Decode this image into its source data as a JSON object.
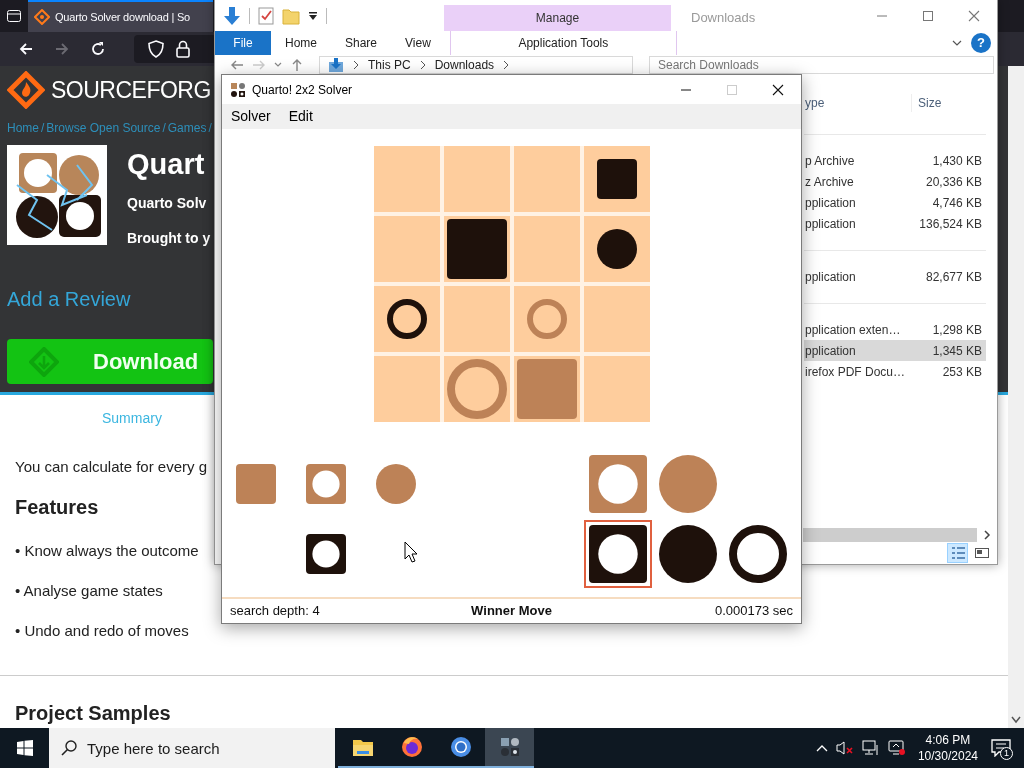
{
  "browser": {
    "tab": {
      "title": "Quarto Solver download | So",
      "selected": true
    },
    "nav_buttons": [
      {
        "kind": "back",
        "disabled": false
      },
      {
        "kind": "forward",
        "disabled": true
      },
      {
        "kind": "reload",
        "disabled": false
      }
    ],
    "page": {
      "logo": "SOURCE**FORG**",
      "breadcrumbs": [
        {
          "label": "Home",
          "separator": "/"
        },
        {
          "label": "Browse Open Source",
          "separator": "/"
        },
        {
          "label": "Games",
          "separator": "/"
        }
      ],
      "project": {
        "title": "Quart",
        "subtitle": "Quarto Solv",
        "byline": "Brought to y"
      },
      "review_link": "Add a Review",
      "download_button": "Download",
      "tabs": [
        {
          "label": "Summary",
          "selected": true
        }
      ],
      "description": "You can calculate for every g",
      "features_heading": "Features",
      "features": [
        "• Know always the outcome",
        "• Analyse game states",
        "• Undo and redo of moves"
      ],
      "samples_heading": "Project Samples"
    }
  },
  "explorer": {
    "title": "Downloads",
    "contextual_tab": "Manage",
    "controls": [
      {
        "kind": "minimize",
        "disabled": false
      },
      {
        "kind": "maximize",
        "disabled": false
      },
      {
        "kind": "close",
        "disabled": false
      }
    ],
    "ribbon_tabs": [
      {
        "label": "File",
        "kind": "file"
      },
      {
        "label": "Home",
        "kind": "tab"
      },
      {
        "label": "Share",
        "kind": "tab"
      },
      {
        "label": "View",
        "kind": "tab"
      },
      {
        "label": "Application Tools",
        "kind": "contextual"
      }
    ],
    "help_button": "?",
    "address": {
      "path": [
        "This PC",
        "Downloads"
      ]
    },
    "search": {
      "placeholder": "Search Downloads"
    },
    "columns": [
      "ype",
      "Size"
    ],
    "groups": [
      {
        "rows": [
          {
            "type": "p Archive",
            "size": "1,430 KB",
            "selected": false
          },
          {
            "type": "z Archive",
            "size": "20,336 KB",
            "selected": false
          },
          {
            "type": "pplication",
            "size": "4,746 KB",
            "selected": false
          },
          {
            "type": "pplication",
            "size": "136,524 KB",
            "selected": false
          }
        ]
      },
      {
        "rows": [
          {
            "type": "pplication",
            "size": "82,677 KB",
            "selected": false
          }
        ]
      },
      {
        "rows": [
          {
            "type": "pplication exten…",
            "size": "1,298 KB",
            "selected": false
          },
          {
            "type": "pplication",
            "size": "1,345 KB",
            "selected": true
          },
          {
            "type": "irefox PDF Docu…",
            "size": "253 KB",
            "selected": false
          }
        ]
      }
    ],
    "view_modes": [
      {
        "kind": "details",
        "selected": true
      },
      {
        "kind": "large_icons",
        "selected": false
      }
    ]
  },
  "solver": {
    "title": "Quarto! 2x2 Solver",
    "controls": [
      {
        "kind": "minimize",
        "disabled": false
      },
      {
        "kind": "maximize",
        "disabled": true
      },
      {
        "kind": "close",
        "disabled": false
      }
    ],
    "menu": [
      "Solver",
      "Edit"
    ],
    "board": {
      "rows": [
        [
          {},
          {},
          {},
          {
            "piece": {
              "kind": "dark_square_small",
              "hollow": false
            }
          }
        ],
        [
          {},
          {
            "piece": {
              "kind": "dark_square_big",
              "hollow": false
            }
          },
          {},
          {
            "piece": {
              "kind": "dark_round_small",
              "hollow": false
            }
          }
        ],
        [
          {
            "piece": {
              "kind": "dark_round_small",
              "hollow": true
            }
          },
          {},
          {
            "piece": {
              "kind": "light_round_small",
              "hollow": true
            }
          },
          {}
        ],
        [
          {},
          {
            "piece": {
              "kind": "light_round_big",
              "hollow": true
            }
          },
          {
            "piece": {
              "kind": "light_square_big",
              "hollow": false
            }
          },
          {}
        ]
      ]
    },
    "pool": [
      {
        "rows": [
          [
            {
              "piece": {
                "kind": "light_square_small",
                "hollow": false
              },
              "selected": false
            },
            {
              "piece": {
                "kind": "light_square_small",
                "hollow": true
              },
              "selected": false
            },
            {
              "piece": {
                "kind": "light_round_small",
                "hollow": false
              },
              "selected": false
            }
          ],
          [
            {},
            {
              "piece": {
                "kind": "dark_square_small",
                "hollow": true
              },
              "selected": false
            },
            {}
          ]
        ]
      },
      {
        "rows": [
          [
            {
              "piece": {
                "kind": "light_square_big",
                "hollow": true
              },
              "selected": false
            },
            {
              "piece": {
                "kind": "light_round_big",
                "hollow": false
              },
              "selected": false
            },
            {}
          ],
          [
            {
              "piece": {
                "kind": "dark_square_big",
                "hollow": true
              },
              "selected": true
            },
            {
              "piece": {
                "kind": "dark_round_big",
                "hollow": false
              },
              "selected": false
            },
            {
              "piece": {
                "kind": "dark_round_big",
                "hollow": true
              },
              "selected": false
            }
          ]
        ]
      }
    ],
    "status": {
      "depth": "search depth: 4",
      "result": "Winner Move",
      "time": "0.000173 sec"
    }
  },
  "taskbar": {
    "search": {
      "placeholder": "Type here to search"
    },
    "apps": [
      {
        "kind": "files",
        "selected": false
      },
      {
        "kind": "firefox",
        "selected": false
      },
      {
        "kind": "chromium",
        "selected": false
      },
      {
        "kind": "quarto",
        "selected": true
      }
    ],
    "clock": {
      "time": "4:06 PM",
      "date": "10/30/2024"
    },
    "notifications": {
      "count": "1"
    }
  }
}
